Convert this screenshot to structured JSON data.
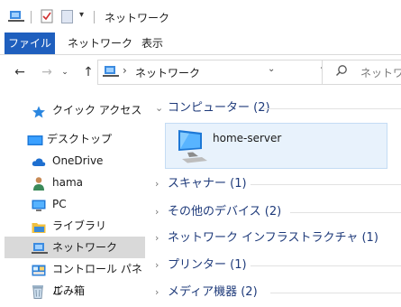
{
  "window": {
    "title": "ネットワーク"
  },
  "ribbon": {
    "tabs": [
      "ファイル",
      "ネットワーク",
      "表示"
    ]
  },
  "address": {
    "path": "ネットワーク",
    "search_placeholder": "ネットワ"
  },
  "nav": {
    "items": [
      {
        "label": "クイック アクセス",
        "icon": "star-icon",
        "selected": false
      },
      {
        "label": "デスクトップ",
        "icon": "desktop-icon",
        "selected": false
      },
      {
        "label": "OneDrive",
        "icon": "cloud-icon",
        "selected": false
      },
      {
        "label": "hama",
        "icon": "user-icon",
        "selected": false
      },
      {
        "label": "PC",
        "icon": "pc-icon",
        "selected": false
      },
      {
        "label": "ライブラリ",
        "icon": "library-icon",
        "selected": false
      },
      {
        "label": "ネットワーク",
        "icon": "network-icon",
        "selected": true
      },
      {
        "label": "コントロール パネル",
        "icon": "control-panel-icon",
        "selected": false
      },
      {
        "label": "ごみ箱",
        "icon": "recycle-bin-icon",
        "selected": false
      }
    ]
  },
  "content": {
    "groups": [
      {
        "label": "コンピューター (2)",
        "expanded": true
      },
      {
        "label": "スキャナー (1)",
        "expanded": false
      },
      {
        "label": "その他のデバイス (2)",
        "expanded": false
      },
      {
        "label": "ネットワーク インフラストラクチャ (1)",
        "expanded": false
      },
      {
        "label": "プリンター (1)",
        "expanded": false
      },
      {
        "label": "メディア機器 (2)",
        "expanded": false
      }
    ],
    "computer_item": {
      "label": "home-server",
      "icon": "computer-icon"
    }
  },
  "colors": {
    "accent": "#1f5fbe",
    "group_text": "#1e3a7a",
    "selected_bg": "#d9d9d9",
    "tile_bg": "#e8f2fc"
  }
}
